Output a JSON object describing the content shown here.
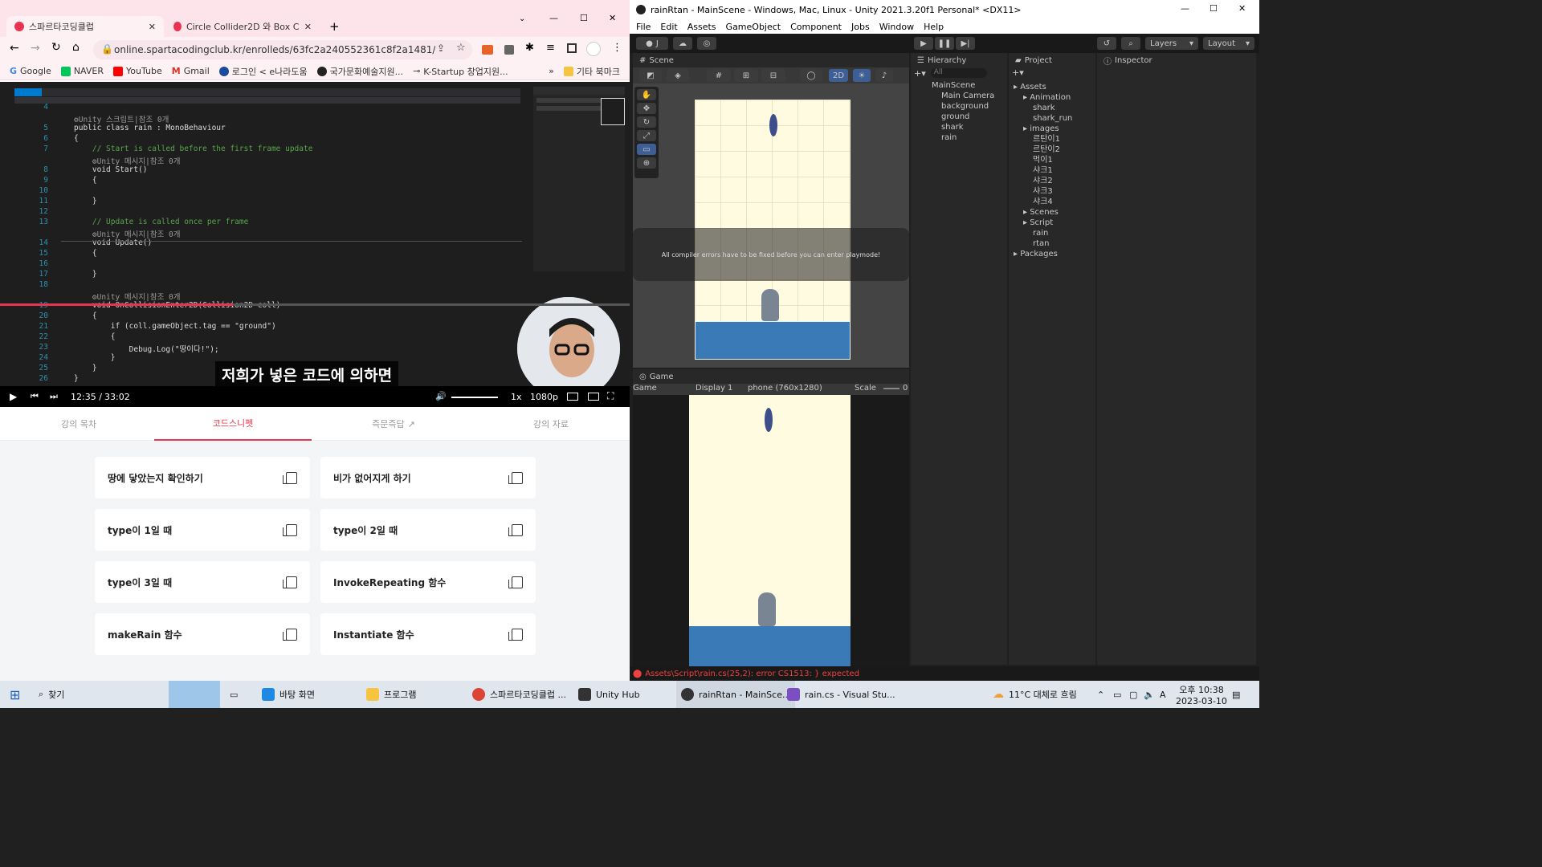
{
  "chrome": {
    "tabs": [
      "스파르타코딩클럽",
      "Circle Collider2D 와 Box Collide"
    ],
    "url": "online.spartacodingclub.kr/enrolleds/63fc2a240552361c8f2a1481/edetails...",
    "bookmarks": [
      "Google",
      "NAVER",
      "YouTube",
      "Gmail",
      "로그인 < e나라도움",
      "국가문화예술지원...",
      "K-Startup 창업지원...",
      "기타 북마크"
    ],
    "bookmark_more": "»"
  },
  "video": {
    "subtitle": "저희가 넣은 코드에 의하면",
    "time": "12:35 /",
    "duration": "33:02",
    "speed": "1x",
    "quality": "1080p",
    "progress": 0.37,
    "code_lines": [
      {
        "n": "4",
        "t": ""
      },
      {
        "n": "",
        "t": "⚙Unity 스크립트|참조 0개",
        "c": "gr"
      },
      {
        "n": "5",
        "t": "public class rain : MonoBehaviour"
      },
      {
        "n": "6",
        "t": "{"
      },
      {
        "n": "7",
        "t": "    // Start is called before the first frame update",
        "c": "cm"
      },
      {
        "n": "",
        "t": "    ⚙Unity 메시지|참조 0개",
        "c": "gr"
      },
      {
        "n": "8",
        "t": "    void Start()"
      },
      {
        "n": "9",
        "t": "    {"
      },
      {
        "n": "10",
        "t": ""
      },
      {
        "n": "11",
        "t": "    }"
      },
      {
        "n": "12",
        "t": ""
      },
      {
        "n": "13",
        "t": "    // Update is called once per frame",
        "c": "cm"
      },
      {
        "n": "",
        "t": "    ⚙Unity 메시지|참조 0개",
        "c": "gr"
      },
      {
        "n": "14",
        "t": "    void Update()"
      },
      {
        "n": "15",
        "t": "    {"
      },
      {
        "n": "16",
        "t": ""
      },
      {
        "n": "17",
        "t": "    }"
      },
      {
        "n": "18",
        "t": ""
      },
      {
        "n": "",
        "t": "    ⚙Unity 메시지|참조 0개",
        "c": "gr"
      },
      {
        "n": "19",
        "t": "    void OnCollisionEnter2D(Collision2D coll)"
      },
      {
        "n": "20",
        "t": "    {"
      },
      {
        "n": "21",
        "t": "        if (coll.gameObject.tag == \"ground\")"
      },
      {
        "n": "22",
        "t": "        {"
      },
      {
        "n": "23",
        "t": "            Debug.Log(\"땅이다!\");"
      },
      {
        "n": "24",
        "t": "        }"
      },
      {
        "n": "25",
        "t": "    }"
      },
      {
        "n": "26",
        "t": "}"
      }
    ]
  },
  "lesson_tabs": [
    "강의 목차",
    "코드스니펫",
    "즉문즉답",
    "강의 자료"
  ],
  "snippets": [
    "땅에 닿았는지 확인하기",
    "비가 없어지게 하기",
    "type이 1일 때",
    "type이 2일 때",
    "type이 3일 때",
    "InvokeRepeating 함수",
    "makeRain 함수",
    "Instantiate 함수"
  ],
  "unity": {
    "title": "rainRtan - MainScene - Windows, Mac, Linux - Unity 2021.3.20f1 Personal* <DX11>",
    "menu": [
      "File",
      "Edit",
      "Assets",
      "GameObject",
      "Component",
      "Jobs",
      "Window",
      "Help"
    ],
    "account": "J",
    "layers": "Layers",
    "layout": "Layout",
    "scene_tab": "Scene",
    "mode_2d": "2D",
    "hierarchy_tab": "Hierarchy",
    "project_tab": "Project",
    "inspector_tab": "Inspector",
    "search_placeholder": "All",
    "hierarchy_root": "MainScene",
    "hierarchy": [
      "Main Camera",
      "background",
      "ground",
      "shark",
      "rain"
    ],
    "project_tree": [
      {
        "label": "Assets",
        "indent": 0
      },
      {
        "label": "Animation",
        "indent": 1
      },
      {
        "label": "shark",
        "indent": 2
      },
      {
        "label": "shark_run",
        "indent": 2
      },
      {
        "label": "images",
        "indent": 1
      },
      {
        "label": "르탄이1",
        "indent": 2
      },
      {
        "label": "르탄이2",
        "indent": 2
      },
      {
        "label": "먹이1",
        "indent": 2
      },
      {
        "label": "샤크1",
        "indent": 2
      },
      {
        "label": "샤크2",
        "indent": 2
      },
      {
        "label": "샤크3",
        "indent": 2
      },
      {
        "label": "샤크4",
        "indent": 2
      },
      {
        "label": "Scenes",
        "indent": 1
      },
      {
        "label": "Script",
        "indent": 1
      },
      {
        "label": "rain",
        "indent": 2
      },
      {
        "label": "rtan",
        "indent": 2
      },
      {
        "label": "Packages",
        "indent": 0
      }
    ],
    "compiler_msg": "All compiler errors have to be fixed before you can enter playmode!",
    "game_tab": "Game",
    "game_dropdown": "Game",
    "display": "Display 1",
    "resolution": "phone (760x1280)",
    "scale_label": "Scale",
    "scale_value": "0",
    "error": "Assets\\Script\\rain.cs(25,2): error CS1513: } expected"
  },
  "taskbar": {
    "search": "찾기",
    "apps": [
      "바탕 화면",
      "프로그램",
      "스파르타코딩클럽 ...",
      "Unity Hub",
      "rainRtan - MainSce...",
      "rain.cs - Visual Stu..."
    ],
    "weather": "11°C 대체로 흐림",
    "ampm_time": "오후 10:38",
    "date": "2023-03-10",
    "ime": "A"
  }
}
